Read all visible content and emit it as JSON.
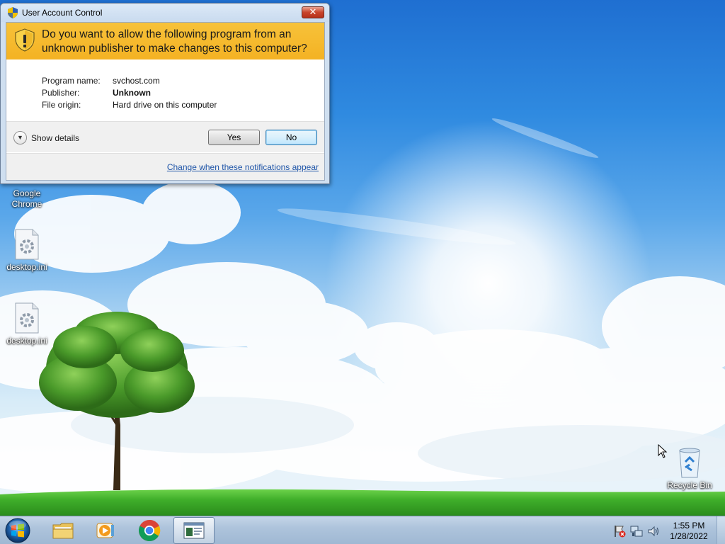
{
  "dialog": {
    "title": "User Account Control",
    "close_label": "✕",
    "question": "Do you want to allow the following program from an unknown publisher to make changes to this computer?",
    "fields": [
      {
        "label": "Program name:",
        "value": "svchost.com"
      },
      {
        "label": "Publisher:",
        "value": "Unknown"
      },
      {
        "label": "File origin:",
        "value": "Hard drive on this computer"
      }
    ],
    "show_details_label": "Show details",
    "yes_label": "Yes",
    "no_label": "No",
    "change_link": "Change when these notifications appear"
  },
  "desktop_icons": [
    {
      "label": "Google\nChrome",
      "icon": "chrome-icon"
    },
    {
      "label": "desktop.ini",
      "icon": "settings-file-icon"
    },
    {
      "label": "desktop.ini",
      "icon": "settings-file-icon"
    },
    {
      "label": "Recycle Bin",
      "icon": "recycle-bin-icon"
    }
  ],
  "taskbar": {
    "pinned": [
      {
        "name": "file-explorer",
        "icon": "folder-icon"
      },
      {
        "name": "media-player",
        "icon": "media-player-icon"
      },
      {
        "name": "chrome",
        "icon": "chrome-icon"
      },
      {
        "name": "uac-window",
        "icon": "window-icon"
      }
    ],
    "clock_time": "1:55 PM",
    "clock_date": "1/28/2022"
  },
  "colors": {
    "banner": "#f4b223",
    "link": "#1f55a8",
    "sky": "#2f8ae0",
    "grass": "#3fae2a"
  }
}
